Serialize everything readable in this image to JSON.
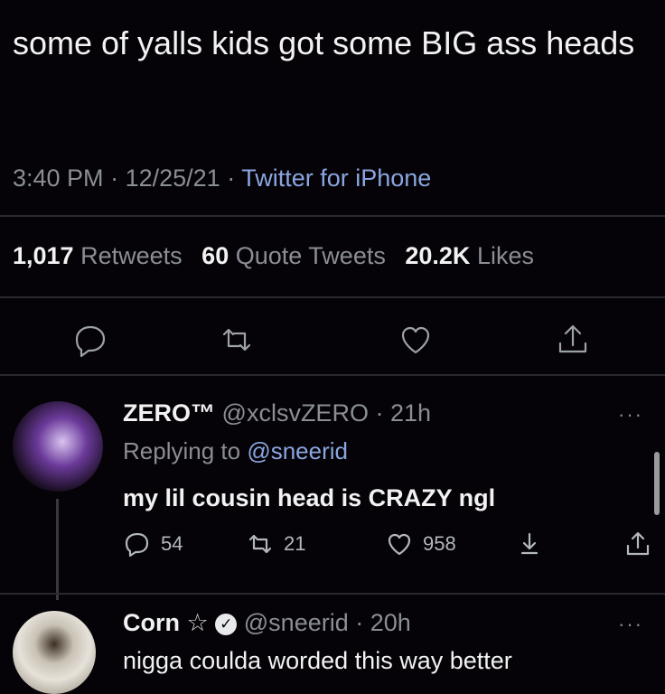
{
  "tweet": {
    "text": "some of yalls kids got some BIG ass heads",
    "time": "3:40 PM",
    "date": "12/25/21",
    "source": "Twitter for iPhone",
    "sep": "·"
  },
  "stats": {
    "retweets_count": "1,017",
    "retweets_label": "Retweets",
    "quotes_count": "60",
    "quotes_label": "Quote Tweets",
    "likes_count": "20.2K",
    "likes_label": "Likes"
  },
  "replies": [
    {
      "name": "ZERO™",
      "handle": "@xclsvZERO",
      "time": "21h",
      "replying_prefix": "Replying to",
      "replying_to": "@sneerid",
      "text": "my lil cousin head is CRAZY ngl",
      "reply_count": "54",
      "retweet_count": "21",
      "like_count": "958"
    },
    {
      "name": "Corn",
      "handle": "@sneerid",
      "time": "20h",
      "text": "nigga coulda worded this way better"
    }
  ],
  "more_glyph": "···",
  "star_glyph": "☆",
  "colors": {
    "background": "#050307",
    "link": "#8aa6e0",
    "muted": "#8b8e94"
  }
}
